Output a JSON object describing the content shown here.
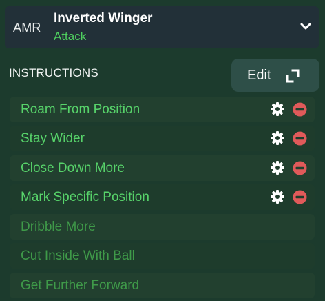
{
  "role": {
    "position_abbr": "AMR",
    "name": "Inverted Winger",
    "duty": "Attack"
  },
  "instructions": {
    "title": "INSTRUCTIONS",
    "edit_label": "Edit",
    "active": [
      {
        "label": "Roam From Position"
      },
      {
        "label": "Stay Wider"
      },
      {
        "label": "Close Down More"
      },
      {
        "label": "Mark Specific Position"
      }
    ],
    "inactive": [
      {
        "label": "Dribble More"
      },
      {
        "label": "Cut Inside With Ball"
      },
      {
        "label": "Get Further Forward"
      }
    ]
  },
  "colors": {
    "background": "#1c3b2d",
    "header_bg": "#223038",
    "accent_green": "#57d36a",
    "muted_green": "#3f9a49",
    "remove_red": "#e05a5a"
  },
  "icons": {
    "dropdown": "chevron-down-icon",
    "expand": "expand-icon",
    "settings": "gear-icon",
    "remove": "remove-icon"
  }
}
